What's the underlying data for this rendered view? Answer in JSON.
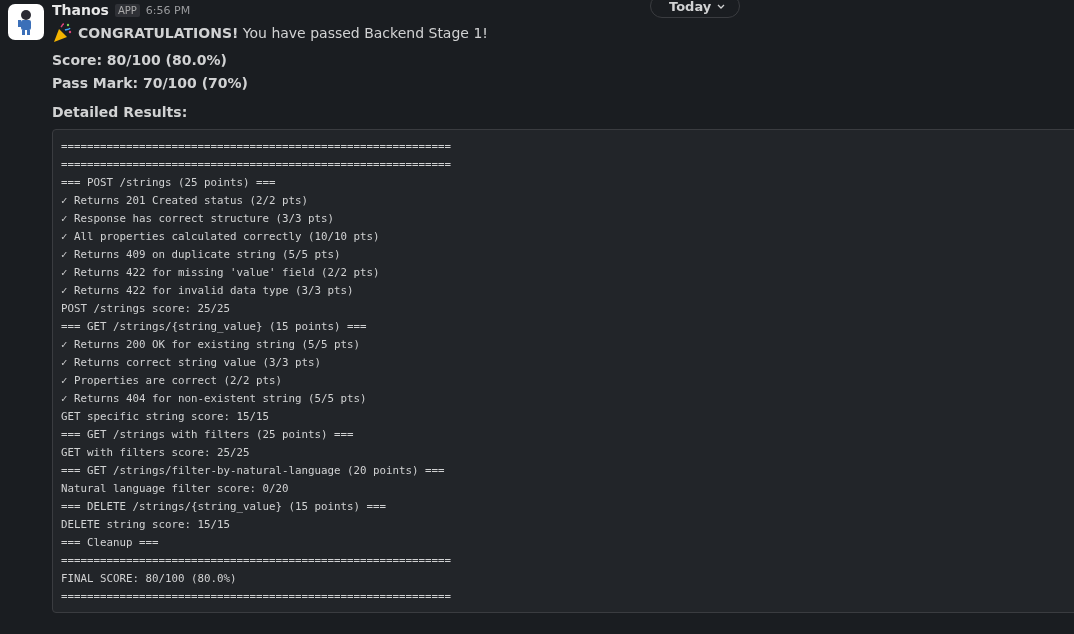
{
  "date_divider": {
    "label": "Today"
  },
  "message": {
    "author": "Thanos",
    "badge": "APP",
    "time": "6:56 PM",
    "headline": "**CONGRATULATIONS!** You have passed Backend Stage 1!",
    "score": "Score: 80/100 (80.0%)",
    "pass_mark": "Pass Mark: 70/100 (70%)",
    "details_label": "Detailed Results:",
    "code_lines": [
      "============================================================",
      "============================================================",
      "=== POST /strings (25 points) ===",
      "✓ Returns 201 Created status (2/2 pts)",
      "✓ Response has correct structure (3/3 pts)",
      "✓ All properties calculated correctly (10/10 pts)",
      "✓ Returns 409 on duplicate string (5/5 pts)",
      "✓ Returns 422 for missing 'value' field (2/2 pts)",
      "✓ Returns 422 for invalid data type (3/3 pts)",
      "POST /strings score: 25/25",
      "=== GET /strings/{string_value} (15 points) ===",
      "✓ Returns 200 OK for existing string (5/5 pts)",
      "✓ Returns correct string value (3/3 pts)",
      "✓ Properties are correct (2/2 pts)",
      "✓ Returns 404 for non-existent string (5/5 pts)",
      "GET specific string score: 15/15",
      "=== GET /strings with filters (25 points) ===",
      "GET with filters score: 25/25",
      "=== GET /strings/filter-by-natural-language (20 points) ===",
      "Natural language filter score: 0/20",
      "=== DELETE /strings/{string_value} (15 points) ===",
      "DELETE string score: 15/15",
      "=== Cleanup ===",
      "============================================================",
      "FINAL SCORE: 80/100 (80.0%)",
      "============================================================"
    ]
  }
}
